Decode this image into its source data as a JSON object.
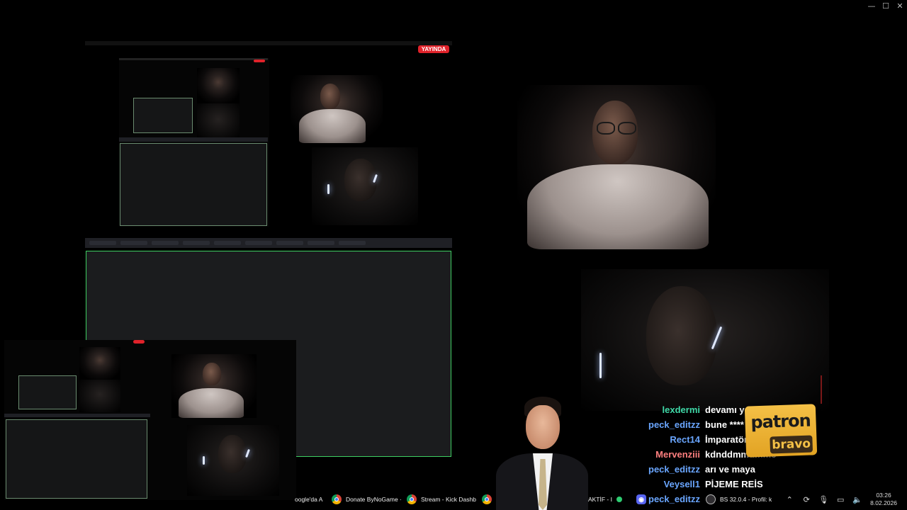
{
  "window": {
    "controls": {
      "minimize": "—",
      "maximize": "☐",
      "close": "✕"
    }
  },
  "stream_preview": {
    "live_badge": "YAYINDA"
  },
  "chat": {
    "messages": [
      {
        "user": "lexdermi",
        "message": "devamı yo",
        "color": "#3fd9a8"
      },
      {
        "user": "peck_editzz",
        "message": "bune ****",
        "color": "#6aa6ff"
      },
      {
        "user": "Rect14",
        "message": "İmparatör",
        "color": "#6aa6ff"
      },
      {
        "user": "Mervenziii",
        "message": "kdnddmmdmme",
        "color": "#ff7f7f"
      },
      {
        "user": "peck_editzz",
        "message": "arı ve maya",
        "color": "#6aa6ff"
      },
      {
        "user": "Veysell1",
        "message": "PİJEME REİS",
        "color": "#6aa6ff"
      },
      {
        "user": "peck_editzz",
        "message": "",
        "color": "#6aa6ff"
      }
    ]
  },
  "sticker": {
    "top": "patron",
    "bottom": "bravo"
  },
  "taskbar": {
    "items": [
      {
        "label": "oogle'da A",
        "icon": "none"
      },
      {
        "label": "Donate ByNoGame ·",
        "icon": "chrome-icon"
      },
      {
        "label": "Stream - Kick Dashb",
        "icon": "chrome-icon"
      },
      {
        "label": "",
        "icon": "chrome-icon"
      },
      {
        "label": "ayın AKTİF - I",
        "icon": "none"
      },
      {
        "label": "",
        "icon": "discord-icon"
      },
      {
        "label": "BS 32.0.4 - Profil: k",
        "icon": "obs-icon"
      }
    ],
    "clock": {
      "time": "03:26",
      "date": "8.02.2026"
    }
  }
}
